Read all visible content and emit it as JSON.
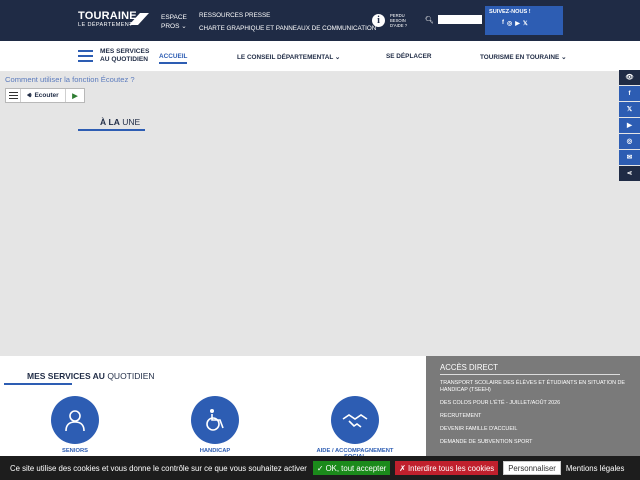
{
  "header": {
    "logo": {
      "line1": "TOURAINE",
      "line2": "LE DÉPARTEMENT"
    },
    "espace_pros": {
      "line1": "ESPACE",
      "line2": "PROS"
    },
    "ressources": [
      "RESSOURCES PRESSE",
      "CHARTE GRAPHIQUE ET PANNEAUX DE COMMUNICATION"
    ],
    "aide": {
      "line1": "PERDU",
      "line2": "BESOIN",
      "line3": "D'AIDE ?"
    },
    "search": {
      "value": ""
    },
    "follow": {
      "title": "SUIVEZ-NOUS !",
      "icons": [
        "f",
        "◎",
        "▶",
        "𝕏"
      ]
    }
  },
  "nav": {
    "mes_services": {
      "line1": "MES SERVICES",
      "line2": "AU QUOTIDIEN"
    },
    "items": [
      "ACCUEIL",
      "LE CONSEIL DÉPARTEMENTAL",
      "SE DÉPLACER",
      "TOURISME EN TOURAINE"
    ]
  },
  "content": {
    "how_to": "Comment utiliser la fonction Écoutez ?",
    "player": {
      "listen_label": "Ecouter"
    },
    "une": {
      "strong": "À LA",
      "rest": "UNE"
    }
  },
  "social_sidebar": [
    "👁",
    "f",
    "𝕏",
    "▶",
    "◎",
    "✉",
    "⋖"
  ],
  "services": {
    "title_strong": "MES SERVICES AU",
    "title_rest": "QUOTIDIEN",
    "items": [
      {
        "label": "SENIORS"
      },
      {
        "label": "HANDICAP"
      },
      {
        "label": "AIDE / ACCOMPAGNEMENT SOCIAL"
      }
    ]
  },
  "acces_direct": {
    "title": "ACCÈS DIRECT",
    "links": [
      "TRANSPORT SCOLAIRE DES ÉLÈVES ET ÉTUDIANTS EN SITUATION DE HANDICAP (TSEEH)",
      "DES COLOS POUR L'ÉTÉ - JUILLET/AOÛT 2026",
      "RECRUTEMENT",
      "DEVENIR FAMILLE D'ACCUEIL",
      "DEMANDE DE SUBVENTION SPORT"
    ]
  },
  "cookie": {
    "message": "Ce site utilise des cookies et vous donne le contrôle sur ce que vous souhaitez activer",
    "accept": "✓ OK, tout accepter",
    "deny": "✗ Interdire tous les cookies",
    "customize": "Personnaliser",
    "legal": "Mentions légales"
  },
  "colors": {
    "navy": "#1f2b45",
    "blue": "#2d5db3",
    "gray_panel": "#7a7a7a",
    "content_bg": "#e5e5e5"
  }
}
